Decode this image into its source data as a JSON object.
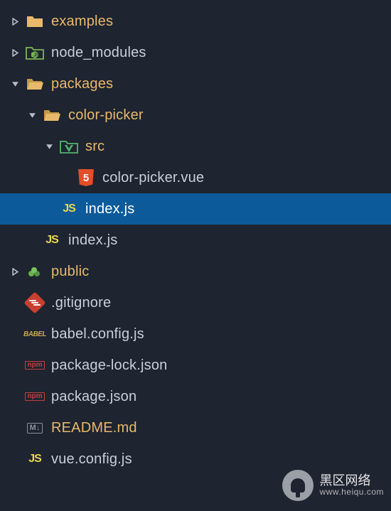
{
  "tree": {
    "examples": "examples",
    "node_modules": "node_modules",
    "packages": "packages",
    "color_picker": "color-picker",
    "src": "src",
    "color_picker_vue": "color-picker.vue",
    "index_js_inner": "index.js",
    "index_js_outer": "index.js",
    "public": "public",
    "gitignore": ".gitignore",
    "babel_config": "babel.config.js",
    "package_lock": "package-lock.json",
    "package_json": "package.json",
    "readme": "README.md",
    "vue_config": "vue.config.js"
  },
  "icons": {
    "html5": "5",
    "js": "JS",
    "babel": "BABEL",
    "npm": "npm",
    "md": "M↓"
  },
  "watermark": {
    "line1": "黑区网络",
    "line2": "www.heiqu.com"
  },
  "colors": {
    "folder": "#e8b96a",
    "node_green": "#7bb755",
    "public_green": "#6ab04c",
    "selected_bg": "#0d5a9a"
  }
}
